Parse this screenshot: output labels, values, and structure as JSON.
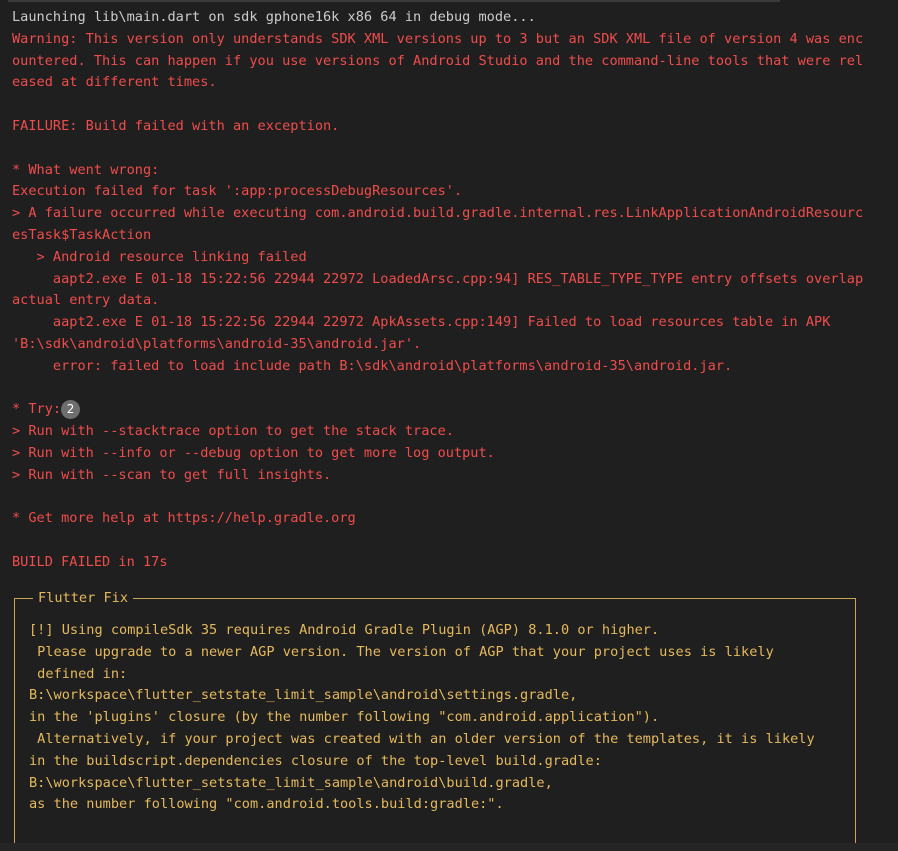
{
  "terminal": {
    "lines": [
      {
        "text": "Launching lib\\main.dart on sdk gphone16k x86 64 in debug mode...",
        "color": "white"
      },
      {
        "text": "Warning: This version only understands SDK XML versions up to 3 but an SDK XML file of version 4 was enc",
        "color": "red"
      },
      {
        "text": "ountered. This can happen if you use versions of Android Studio and the command-line tools that were rel",
        "color": "red"
      },
      {
        "text": "eased at different times.",
        "color": "red"
      },
      {
        "text": "",
        "color": "red"
      },
      {
        "text": "FAILURE: Build failed with an exception.",
        "color": "red"
      },
      {
        "text": "",
        "color": "red"
      },
      {
        "text": "* What went wrong:",
        "color": "red"
      },
      {
        "text": "Execution failed for task ':app:processDebugResources'.",
        "color": "red"
      },
      {
        "text": "> A failure occurred while executing com.android.build.gradle.internal.res.LinkApplicationAndroidResourc",
        "color": "red"
      },
      {
        "text": "esTask$TaskAction",
        "color": "red"
      },
      {
        "text": "   > Android resource linking failed",
        "color": "red"
      },
      {
        "text": "     aapt2.exe E 01-18 15:22:56 22944 22972 LoadedArsc.cpp:94] RES_TABLE_TYPE_TYPE entry offsets overlap",
        "color": "red"
      },
      {
        "text": "actual entry data.",
        "color": "red"
      },
      {
        "text": "     aapt2.exe E 01-18 15:22:56 22944 22972 ApkAssets.cpp:149] Failed to load resources table in APK",
        "color": "red"
      },
      {
        "text": "'B:\\sdk\\android\\platforms\\android-35\\android.jar'.",
        "color": "red"
      },
      {
        "text": "     error: failed to load include path B:\\sdk\\android\\platforms\\android-35\\android.jar.",
        "color": "red"
      }
    ],
    "collapsed_badge": "2",
    "lines_after": [
      {
        "text": "* Try:",
        "color": "red"
      },
      {
        "text": "> Run with --stacktrace option to get the stack trace.",
        "color": "red"
      },
      {
        "text": "> Run with --info or --debug option to get more log output.",
        "color": "red"
      },
      {
        "text": "> Run with --scan to get full insights.",
        "color": "red"
      },
      {
        "text": "",
        "color": "red"
      },
      {
        "text": "* Get more help at https://help.gradle.org",
        "color": "red"
      },
      {
        "text": "",
        "color": "red"
      },
      {
        "text": "BUILD FAILED in 17s",
        "color": "red"
      }
    ],
    "flutter_fix": {
      "title": "Flutter Fix",
      "lines": [
        "[!] Using compileSdk 35 requires Android Gradle Plugin (AGP) 8.1.0 or higher.",
        " Please upgrade to a newer AGP version. The version of AGP that your project uses is likely",
        " defined in:",
        "B:\\workspace\\flutter_setstate_limit_sample\\android\\settings.gradle,",
        "in the 'plugins' closure (by the number following \"com.android.application\").",
        " Alternatively, if your project was created with an older version of the templates, it is likely",
        "in the buildscript.dependencies closure of the top-level build.gradle:",
        "B:\\workspace\\flutter_setstate_limit_sample\\android\\build.gradle,",
        "as the number following \"com.android.tools.build:gradle:\".",
        ""
      ]
    }
  },
  "colors": {
    "background": "#1f1f1f",
    "text_default": "#cccccc",
    "text_error": "#f14c4c",
    "text_fix": "#e5b95c",
    "fix_border": "#c9a64f"
  }
}
